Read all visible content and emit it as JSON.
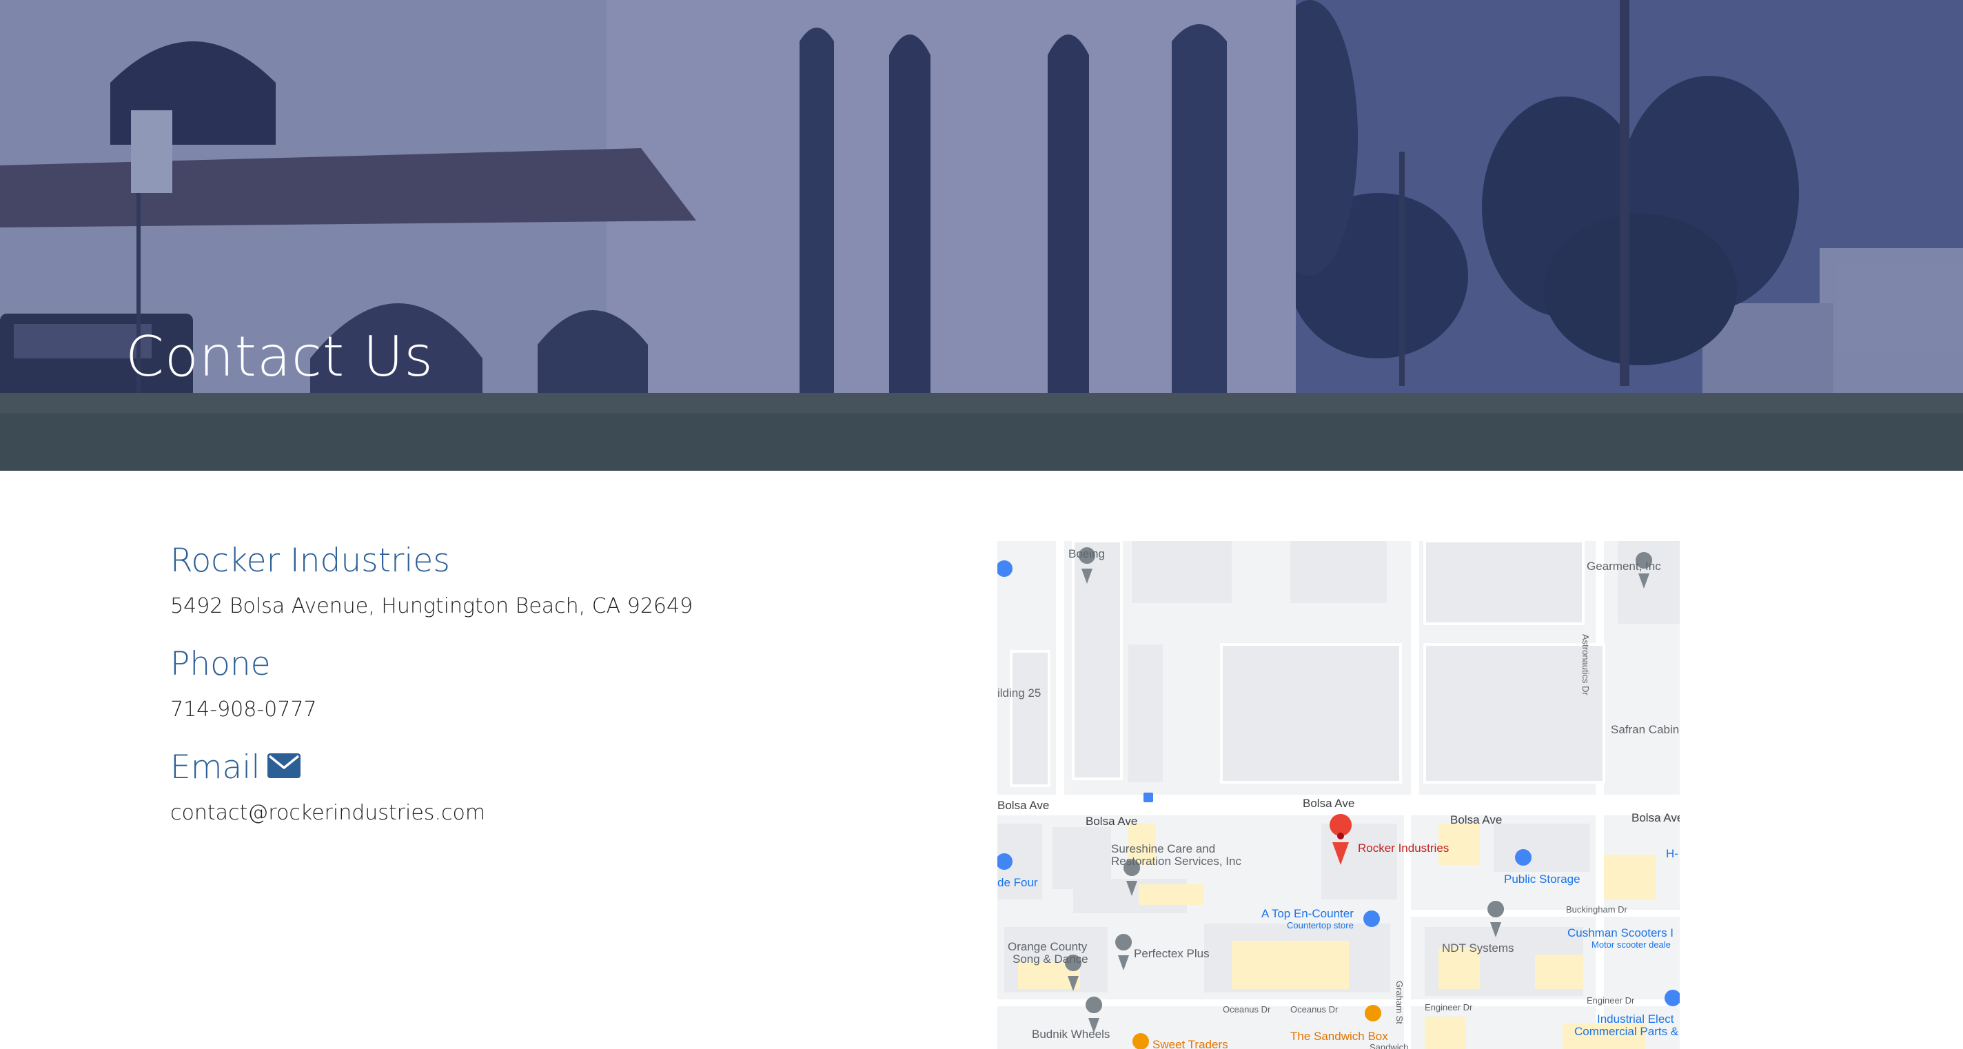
{
  "hero": {
    "title": "Contact Us"
  },
  "contact": {
    "company": "Rocker Industries",
    "address": "5492 Bolsa Avenue, Hungtington Beach, CA 92649",
    "phone_heading": "Phone",
    "phone": "714-908-0777",
    "email_heading": "Email",
    "email": "contact@rockerindustries.com",
    "email_icon": "envelope-icon"
  },
  "colors": {
    "heading_blue": "#2c5f96",
    "hero_overlay": "#26346e",
    "text": "#222222",
    "map_pin_red": "#ea4335"
  },
  "map": {
    "labels": {
      "boeing": "Boeing",
      "gearment": "Gearment, Inc",
      "astronautics": "Astronautics Dr",
      "building25": "ilding 25",
      "safran": "Safran Cabin",
      "bolsa1": "Bolsa Ave",
      "bolsa2": "Bolsa Ave",
      "bolsa3": "Bolsa Ave",
      "bolsa4": "Bolsa Ave",
      "bolsa5": "Bolsa Ave",
      "sureshine1": "Sureshine Care and",
      "sureshine2": "Restoration Services, Inc",
      "rocker": "Rocker Industries",
      "h_label": "H-",
      "defour": "de Four",
      "public_storage": "Public Storage",
      "buckingham": "Buckingham Dr",
      "atop1": "A Top En-Counter",
      "atop2": "Countertop store",
      "cushman1": "Cushman Scooters I",
      "cushman2": "Motor scooter deale",
      "ndt": "NDT Systems",
      "orange1": "Orange County",
      "orange2": "Song & Dance",
      "perfectex": "Perfectex Plus",
      "oceanus1": "Oceanus Dr",
      "oceanus2": "Oceanus Dr",
      "graham": "Graham St",
      "engineer1": "Engineer Dr",
      "engineer2": "Engineer Dr",
      "sandwich1": "The Sandwich Box",
      "sandwich2": "Sandwich",
      "budnik": "Budnik Wheels",
      "sweet": "Sweet Traders",
      "industrial1": "Industrial Elect",
      "industrial2": "Commercial Parts &"
    }
  }
}
